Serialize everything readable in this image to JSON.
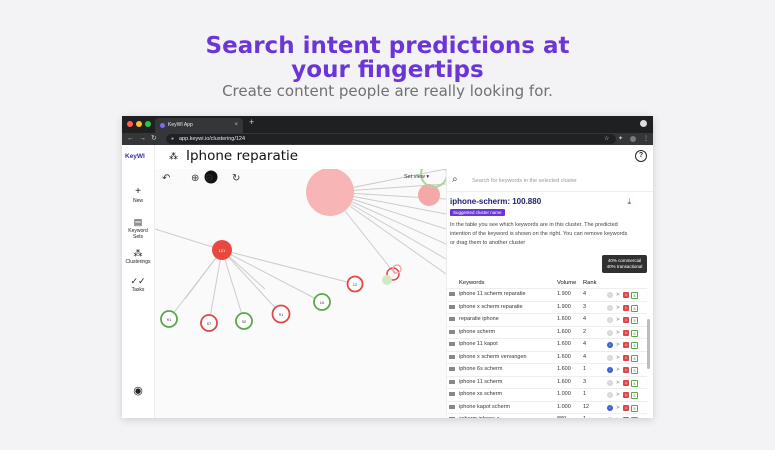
{
  "hero": {
    "title_line1": "Search intent predictions at",
    "title_line2": "your fingertips",
    "subtitle": "Create content people are really looking for."
  },
  "browser": {
    "tab_title": "KeyWI App",
    "url": "app.keywi.io/clustering/124",
    "colors": {
      "close": "#ff5f57",
      "minimize": "#febc2e",
      "maximize": "#28c840"
    }
  },
  "sidebar": {
    "brand": "KeyWI",
    "items": [
      {
        "label": "New",
        "icon": "plus-icon"
      },
      {
        "label": "Keyword\nSets",
        "icon": "document-icon"
      },
      {
        "label": "Clusterings",
        "icon": "clusters-icon"
      },
      {
        "label": "Tasks",
        "icon": "checks-icon"
      }
    ],
    "account_icon": "account-icon"
  },
  "header": {
    "title": "Iphone reparatie",
    "help_icon": "help-icon"
  },
  "graph": {
    "set_view_label": "Set view",
    "nodes": [
      {
        "label": "121"
      },
      {
        "label": "91"
      },
      {
        "label": "97"
      },
      {
        "label": "92"
      },
      {
        "label": "91"
      },
      {
        "label": "10"
      },
      {
        "label": "12"
      }
    ],
    "colors": {
      "hub": "#f36b6b",
      "red_ring": "#e04848",
      "green_ring": "#5aa84a",
      "center": "#f7b5b5"
    }
  },
  "panel": {
    "search_placeholder": "Search for keywords in the selected cluster",
    "cluster_name": "iphone-scherm: 100.880",
    "chip": "Suggested cluster name",
    "description": "In the table you see which keywords are in this cluster. The predicted intention of the keyword is shown on the right. You can remove keywords or drag them to another cluster",
    "tooltip_line1": "40% commercial",
    "tooltip_line2": "40% transactional",
    "columns": {
      "keyword": "Keywords",
      "volume": "Volume",
      "rank": "Rank"
    },
    "rows": [
      {
        "keyword": "iphone 11 scherm reparatie",
        "volume": "1.900",
        "rank": "4"
      },
      {
        "keyword": "iphone x scherm reparatie",
        "volume": "1.900",
        "rank": "3"
      },
      {
        "keyword": "reparatie iphone",
        "volume": "1.600",
        "rank": "4"
      },
      {
        "keyword": "iphone scherm",
        "volume": "1.600",
        "rank": "2"
      },
      {
        "keyword": "iphone 11 kapot",
        "volume": "1.600",
        "rank": "4"
      },
      {
        "keyword": "iphone x scherm vervangen",
        "volume": "1.600",
        "rank": "4"
      },
      {
        "keyword": "iphone 6s scherm",
        "volume": "1.600",
        "rank": "1"
      },
      {
        "keyword": "iphone 11 scherm",
        "volume": "1.600",
        "rank": "3"
      },
      {
        "keyword": "iphone xs scherm",
        "volume": "1.000",
        "rank": "1"
      },
      {
        "keyword": "iphone kapot scherm",
        "volume": "1.000",
        "rank": "12"
      },
      {
        "keyword": "scherm iphone x",
        "volume": "880",
        "rank": "1"
      },
      {
        "keyword": "apple scherm reparatie",
        "volume": "720",
        "rank": "-"
      }
    ]
  }
}
